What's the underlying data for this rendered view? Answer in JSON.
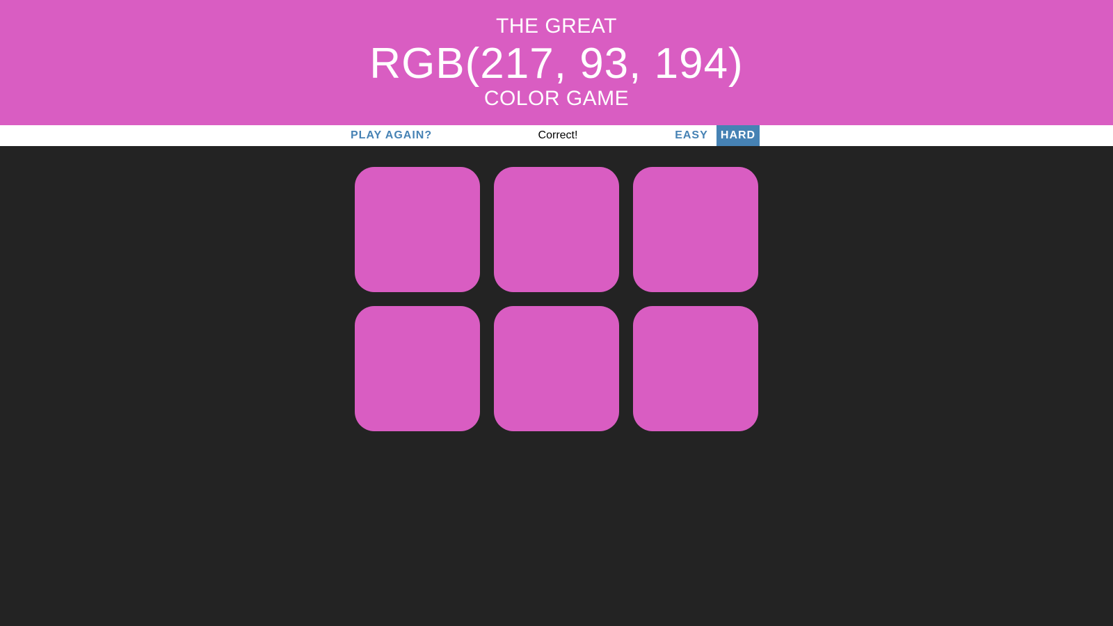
{
  "header": {
    "line1": "THE GREAT",
    "color_display": "RGB(217, 93, 194)",
    "line3": "COLOR GAME",
    "background_color": "#d95dc2"
  },
  "controls": {
    "play_again_label": "PLAY AGAIN?",
    "message": "Correct!",
    "easy_label": "EASY",
    "hard_label": "HARD",
    "selected_mode": "HARD",
    "accent_color": "#4682b4"
  },
  "board": {
    "background_color": "#232323",
    "squares": [
      {
        "color": "#d95dc2"
      },
      {
        "color": "#d95dc2"
      },
      {
        "color": "#d95dc2"
      },
      {
        "color": "#d95dc2"
      },
      {
        "color": "#d95dc2"
      },
      {
        "color": "#d95dc2"
      }
    ]
  }
}
